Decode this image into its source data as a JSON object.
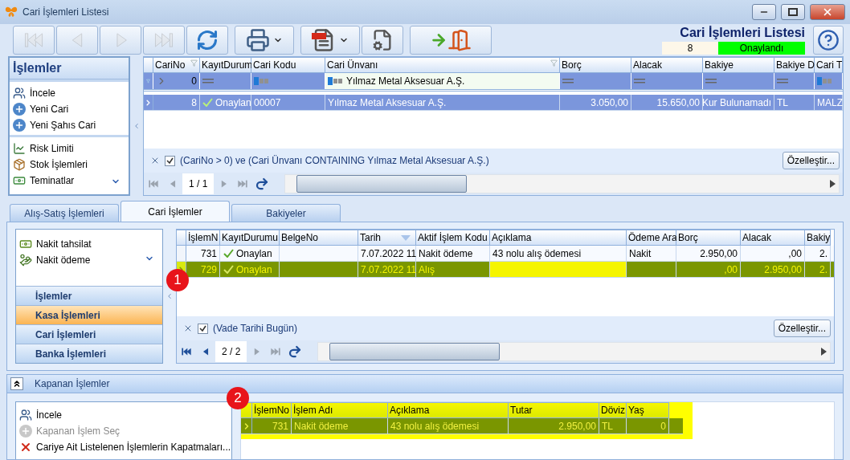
{
  "window": {
    "title": "Cari İşlemleri Listesi"
  },
  "toolbar": [
    {
      "kind": "first",
      "disabled": true
    },
    {
      "kind": "previous",
      "disabled": true
    },
    {
      "kind": "next",
      "disabled": true
    },
    {
      "kind": "last",
      "disabled": true
    },
    {
      "kind": "refresh",
      "disabled": false
    },
    {
      "kind": "print",
      "disabled": false
    },
    {
      "kind": "pdf",
      "disabled": false
    },
    {
      "kind": "report_design",
      "disabled": false
    },
    {
      "kind": "exit",
      "disabled": false
    }
  ],
  "header": {
    "title": "Cari İşlemleri Listesi",
    "record_no": "8",
    "status": "Onaylandı"
  },
  "actions_panel": {
    "title": "İşlemler",
    "sections": [
      {
        "items": [
          {
            "kind": "view",
            "label": "İncele"
          },
          {
            "kind": "add",
            "label": "Yeni Cari"
          },
          {
            "kind": "add",
            "label": "Yeni Şahıs Cari"
          }
        ]
      },
      {
        "items": [
          {
            "kind": "risk",
            "label": "Risk Limiti"
          },
          {
            "kind": "stock",
            "label": "Stok İşlemleri"
          },
          {
            "kind": "collateral",
            "label": "Teminatlar"
          }
        ]
      }
    ]
  },
  "cari_grid": {
    "columns": [
      {
        "label": "CariNo",
        "kind": "number",
        "filtered": true
      },
      {
        "label": "KayıtDurum",
        "kind": "status",
        "filtered": false
      },
      {
        "label": "Cari Kodu",
        "kind": "text",
        "filtered": false
      },
      {
        "label": "Cari Ünvanı",
        "kind": "text",
        "filtered": true
      },
      {
        "label": "Borç",
        "kind": "number",
        "filtered": false
      },
      {
        "label": "Alacak",
        "kind": "number",
        "filtered": false
      },
      {
        "label": "Bakiye",
        "kind": "number",
        "filtered": false
      },
      {
        "label": "Bakiye D",
        "kind": "text",
        "filtered": false
      },
      {
        "label": "Cari T",
        "kind": "text",
        "filtered": false
      }
    ],
    "filter_row": [
      {
        "kind": "gt",
        "value": "0"
      },
      {
        "kind": "eq"
      },
      {
        "kind": "text"
      },
      {
        "kind": "text",
        "value": "Yılmaz Metal Aksesuar A.Ş."
      },
      {
        "kind": "eq"
      },
      {
        "kind": "eq"
      },
      {
        "kind": "eq"
      },
      {
        "kind": "eq"
      },
      {
        "kind": "text"
      }
    ],
    "rows": [
      {
        "selected": true,
        "cells": [
          "8",
          "Onaylan",
          "00007",
          "Yılmaz Metal Aksesuar A.Ş.",
          "3.050,00",
          "15.650,00",
          "Kur Bulunamadı",
          "TL",
          "MALZ"
        ]
      }
    ],
    "filter": {
      "enabled": true,
      "text": "(CariNo > 0) ve (Cari Ünvanı CONTAINING Yılmaz Metal Aksesuar A.Ş.)"
    },
    "customize_button": "Özelleştir...",
    "navigator": {
      "page": "1 / 1",
      "buttons": [
        {
          "kind": "first",
          "disabled": true
        },
        {
          "kind": "previous",
          "disabled": true
        },
        {
          "kind": "next",
          "disabled": true
        },
        {
          "kind": "last",
          "disabled": true
        },
        {
          "kind": "refresh",
          "disabled": false
        }
      ]
    }
  },
  "tabs": [
    {
      "label": "Alış-Satış İşlemleri",
      "selected": false
    },
    {
      "label": "Cari İşlemler",
      "selected": true
    },
    {
      "label": "Bakiyeler",
      "selected": false
    }
  ],
  "navbar": {
    "items": [
      {
        "kind": "cash_in",
        "label": "Nakit tahsilat"
      },
      {
        "kind": "cash_out",
        "label": "Nakit ödeme"
      }
    ],
    "groups": [
      {
        "label": "İşlemler",
        "selected": false
      },
      {
        "label": "Kasa İşlemleri",
        "selected": true
      },
      {
        "label": "Cari İşlemleri",
        "selected": false
      },
      {
        "label": "Banka İşlemleri",
        "selected": false
      }
    ]
  },
  "transactions_grid": {
    "badge": "1",
    "columns": [
      {
        "label": "İşlemN",
        "kind": "number",
        "sorted": false,
        "focused": false
      },
      {
        "label": "KayıtDurumu",
        "kind": "status",
        "sorted": false,
        "focused": false
      },
      {
        "label": "BelgeNo",
        "kind": "text",
        "sorted": false,
        "focused": false
      },
      {
        "label": "Tarih",
        "kind": "text",
        "sorted": true,
        "focused": false
      },
      {
        "label": "Aktif İşlem Kodu",
        "kind": "text",
        "sorted": false,
        "focused": false
      },
      {
        "label": "Açıklama",
        "kind": "text",
        "sorted": false,
        "focused": true
      },
      {
        "label": "Ödeme Ara",
        "kind": "text",
        "sorted": false,
        "focused": false
      },
      {
        "label": "Borç",
        "kind": "number",
        "sorted": false,
        "focused": false
      },
      {
        "label": "Alacak",
        "kind": "number",
        "sorted": false,
        "focused": false
      },
      {
        "label": "Bakiy",
        "kind": "number",
        "sorted": false,
        "focused": false
      }
    ],
    "rows": [
      {
        "selected": false,
        "cells": [
          "731",
          "Onaylan",
          null,
          "7.07.2022 11",
          "Nakit ödeme",
          "43 nolu alış ödemesi",
          "Nakit",
          "2.950,00",
          ",00",
          "2."
        ]
      },
      {
        "selected": true,
        "cells": [
          "729",
          "Onaylan",
          null,
          "7.07.2022 11",
          "Alış",
          null,
          null,
          ",00",
          "2.950,00",
          "2."
        ]
      }
    ],
    "filter": {
      "enabled": true,
      "text": "(Vade Tarihi Bugün)"
    },
    "customize_button": "Özelleştir...",
    "navigator": {
      "page": "2 / 2",
      "buttons": [
        {
          "kind": "first",
          "disabled": false
        },
        {
          "kind": "previous",
          "disabled": false
        },
        {
          "kind": "next",
          "disabled": true
        },
        {
          "kind": "last",
          "disabled": true
        },
        {
          "kind": "refresh",
          "disabled": false
        }
      ]
    }
  },
  "closed_panel": {
    "title": "Kapanan İşlemler",
    "expanded": true,
    "badge": "2",
    "actions": [
      {
        "kind": "view",
        "label": "İncele",
        "disabled": false
      },
      {
        "kind": "add",
        "label": "Kapanan İşlem Seç",
        "disabled": true
      },
      {
        "kind": "delete",
        "label": "Cariye Ait Listelenen İşlemlerin Kapatmaları...",
        "disabled": false
      }
    ],
    "grid": {
      "columns": [
        {
          "label": "İşlemNo",
          "kind": "number"
        },
        {
          "label": "İşlem Adı",
          "kind": "text"
        },
        {
          "label": "Açıklama",
          "kind": "text"
        },
        {
          "label": "Tutar",
          "kind": "number"
        },
        {
          "label": "Döviz",
          "kind": "text"
        },
        {
          "label": "Yaş",
          "kind": "number"
        }
      ],
      "rows": [
        {
          "selected": true,
          "cells": [
            "731",
            "Nakit ödeme",
            "43 nolu alış ödemesi",
            "2.950,00",
            "TL",
            "0"
          ]
        }
      ]
    }
  }
}
